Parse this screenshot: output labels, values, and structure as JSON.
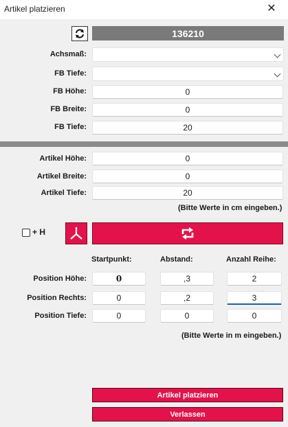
{
  "window": {
    "title": "Artikel platzieren",
    "close_glyph": "✕"
  },
  "id_bar": {
    "value": "136210"
  },
  "fb": {
    "achsmass_label": "Achsmaß:",
    "achsmass_value": "",
    "tiefe_select_label": "FB Tiefe:",
    "tiefe_select_value": "",
    "hoehe_label": "FB Höhe:",
    "hoehe_value": "0",
    "breite_label": "FB Breite:",
    "breite_value": "0",
    "tiefe_label": "FB Tiefe:",
    "tiefe_value": "20"
  },
  "artikel": {
    "hoehe_label": "Artikel Höhe:",
    "hoehe_value": "0",
    "breite_label": "Artikel Breite:",
    "breite_value": "0",
    "tiefe_label": "Artikel Tiefe:",
    "tiefe_value": "20",
    "hint_cm": "(Bitte Werte in cm eingeben.)"
  },
  "orientation": {
    "checkbox_label": "+ H",
    "checked": false
  },
  "position": {
    "col_start": "Startpunkt:",
    "col_abstand": "Abstand:",
    "col_anzahl": "Anzahl Reihe:",
    "rows": [
      {
        "label": "Position Höhe:",
        "start": "0",
        "abstand": ",3",
        "anzahl": "2"
      },
      {
        "label": "Position Rechts:",
        "start": "0",
        "abstand": ",2",
        "anzahl": "3"
      },
      {
        "label": "Position Tiefe:",
        "start": "0",
        "abstand": "0",
        "anzahl": "0"
      }
    ],
    "hint_m": "(Bitte Werte in m eingeben.)"
  },
  "actions": {
    "place_label": "Artikel platzieren",
    "leave_label": "Verlassen"
  },
  "colors": {
    "accent": "#e3124b",
    "id_bar": "#7a7a7a",
    "separator": "#8b8b8b"
  }
}
